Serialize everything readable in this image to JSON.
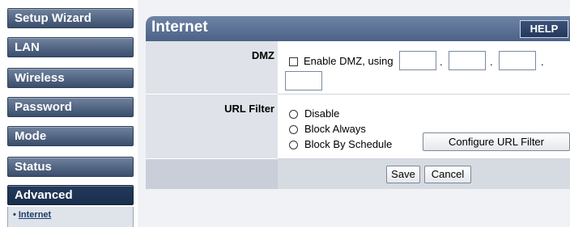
{
  "sidebar": {
    "items": [
      {
        "label": "Setup Wizard"
      },
      {
        "label": "LAN"
      },
      {
        "label": "Wireless"
      },
      {
        "label": "Password"
      },
      {
        "label": "Mode"
      },
      {
        "label": "Status"
      },
      {
        "label": "Advanced"
      }
    ],
    "sub_items": [
      {
        "label": "Internet"
      }
    ]
  },
  "header": {
    "title": "Internet",
    "help_label": "HELP"
  },
  "dmz": {
    "label": "DMZ",
    "checkbox_label": "Enable DMZ, using",
    "checked": false,
    "ip": [
      "",
      "",
      "",
      ""
    ],
    "separator": "."
  },
  "url_filter": {
    "label": "URL Filter",
    "options": [
      {
        "label": "Disable",
        "selected": false
      },
      {
        "label": "Block Always",
        "selected": false
      },
      {
        "label": "Block By Schedule",
        "selected": false
      }
    ],
    "configure_label": "Configure URL Filter"
  },
  "actions": {
    "save_label": "Save",
    "cancel_label": "Cancel"
  }
}
